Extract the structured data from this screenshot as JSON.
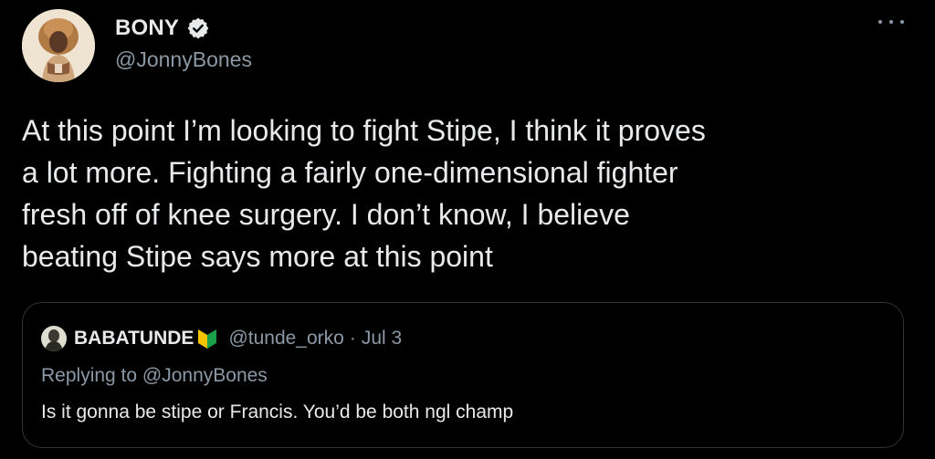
{
  "colors": {
    "background": "#000000",
    "text_primary": "#e7e9ea",
    "text_secondary": "#8b98a5",
    "border": "#2f3336",
    "verified_blue": "#1d9bf0"
  },
  "tweet": {
    "author": {
      "display_name": "BONY",
      "handle": "@JonnyBones",
      "verified": true,
      "avatar_icon": "lion-costume-avatar"
    },
    "more_icon": "more-dots-icon",
    "text": "At this point I’m looking to fight Stipe, I think it proves\na lot more. Fighting a fairly one-dimensional fighter\nfresh off of knee surgery. I don’t know, I believe\nbeating Stipe says more at this point"
  },
  "quoted_tweet": {
    "display_name": "BABATUNDE",
    "badge_icon": "beginner-badge-icon",
    "handle": "@tunde_orko",
    "separator": "·",
    "date": "Jul 3",
    "replying_prefix": "Replying to",
    "replying_to": "@JonnyBones",
    "text": "Is it gonna be stipe or Francis. You’d be both ngl champ"
  }
}
